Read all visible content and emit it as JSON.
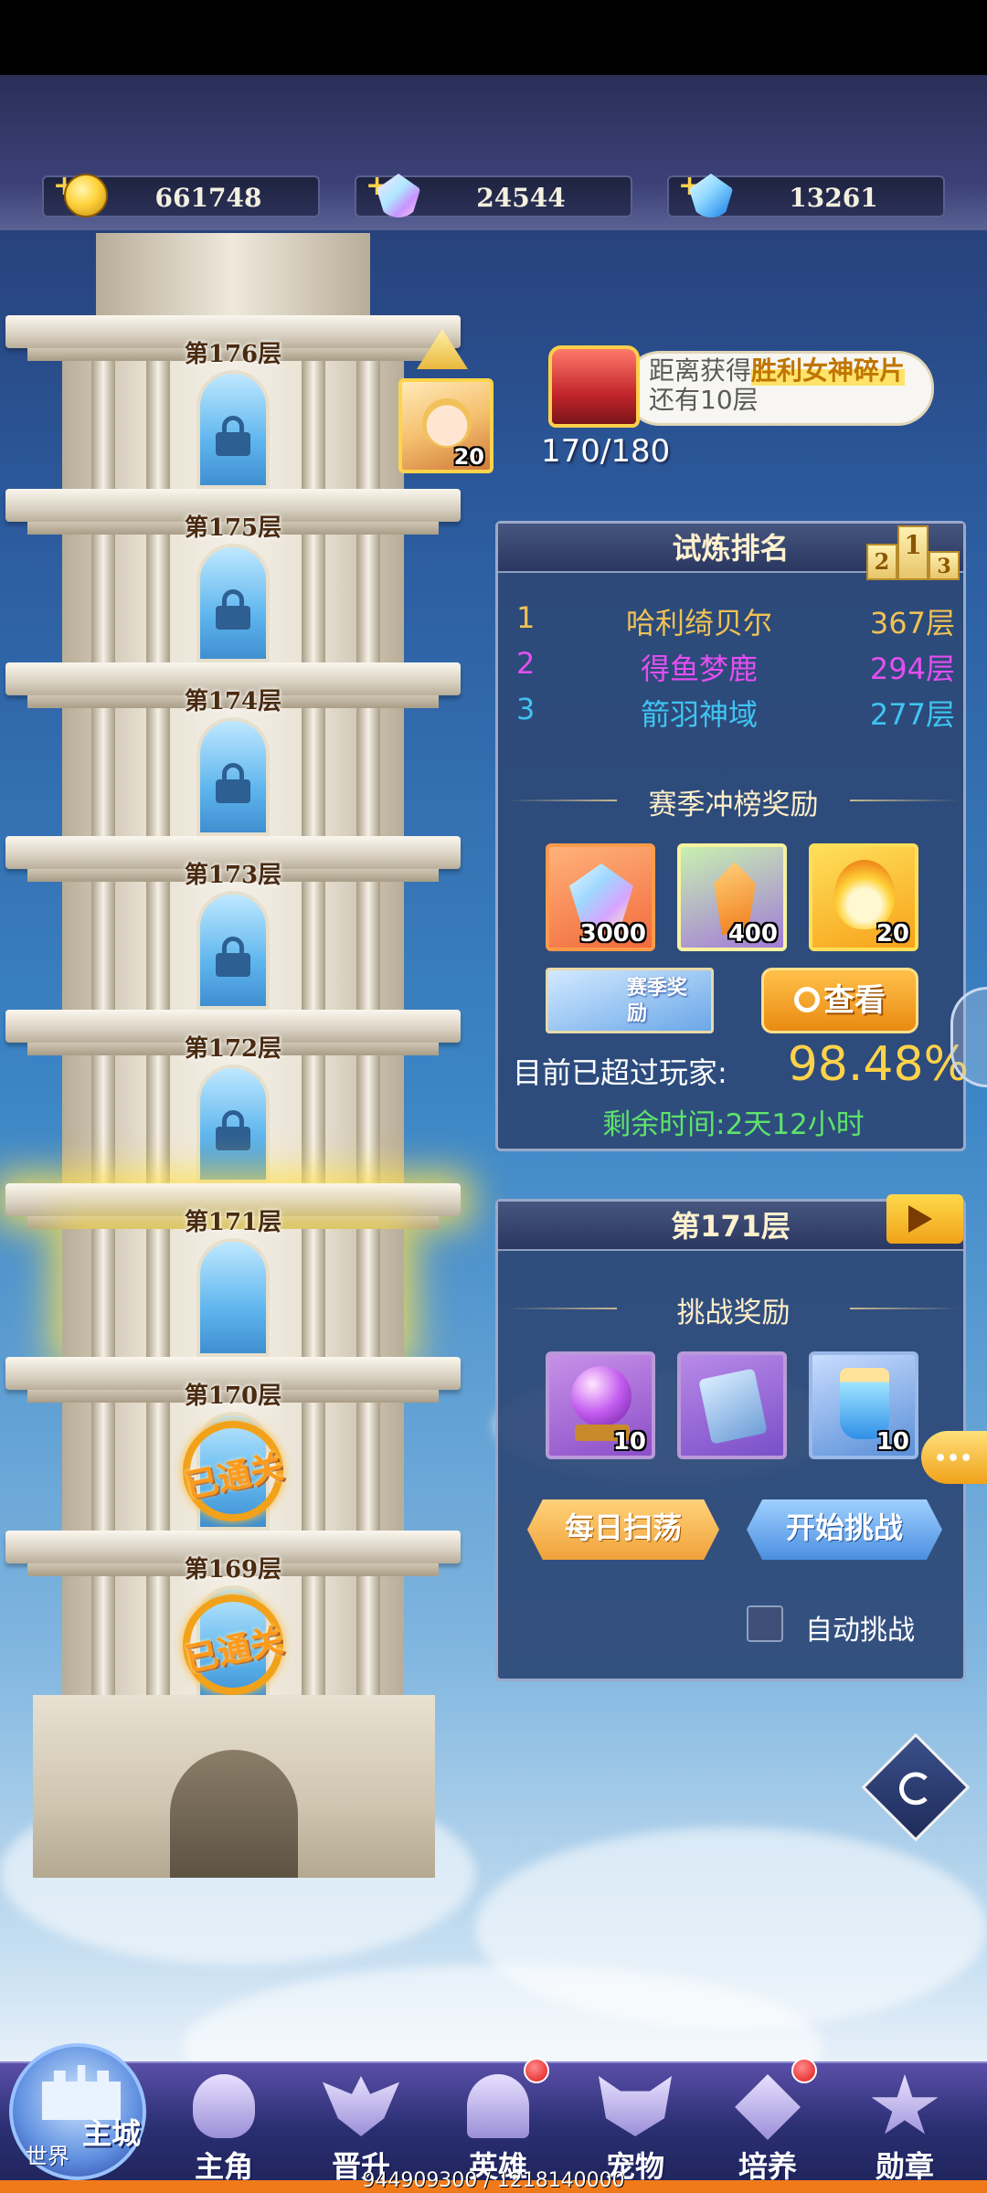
{
  "currencies": [
    {
      "icon": "gold-coin-icon",
      "value": "661748"
    },
    {
      "icon": "rainbow-gem-icon",
      "value": "24544"
    },
    {
      "icon": "blue-diamond-icon",
      "value": "13261"
    }
  ],
  "tower": {
    "floors": [
      {
        "label": "第176层",
        "state": "locked"
      },
      {
        "label": "第175层",
        "state": "locked"
      },
      {
        "label": "第174层",
        "state": "locked"
      },
      {
        "label": "第173层",
        "state": "locked"
      },
      {
        "label": "第172层",
        "state": "locked"
      },
      {
        "label": "第171层",
        "state": "current"
      },
      {
        "label": "第170层",
        "state": "cleared"
      },
      {
        "label": "第169层",
        "state": "cleared"
      }
    ],
    "cleared_text": "已通关",
    "hero_avatar_level": "20"
  },
  "chest": {
    "text_before": "距离获得",
    "highlight": "胜利女神碎片",
    "text_after": "还有10层",
    "progress": "170/180"
  },
  "ranking": {
    "title": "试炼排名",
    "podium": [
      "1",
      "2",
      "3"
    ],
    "rows": [
      {
        "rank": "1",
        "name": "哈利绮贝尔",
        "floor": "367层",
        "color": "#f0c254"
      },
      {
        "rank": "2",
        "name": "得鱼梦鹿",
        "floor": "294层",
        "color": "#e34ff0"
      },
      {
        "rank": "3",
        "name": "箭羽神域",
        "floor": "277层",
        "color": "#3fc4f0"
      }
    ],
    "season_reward_title": "赛季冲榜奖励",
    "rewards": [
      {
        "icon": "crystal-icon",
        "qty": "3000"
      },
      {
        "icon": "orange-shard-icon",
        "qty": "400"
      },
      {
        "icon": "flame-essence-icon",
        "qty": "20"
      }
    ],
    "season_badge": "赛季奖励",
    "view_button": "查看",
    "surpass_label": "目前已超过玩家:",
    "surpass_value": "98.48%",
    "remaining": "剩余时间:2天12小时"
  },
  "floor_panel": {
    "title": "第171层",
    "challenge_reward_title": "挑战奖励",
    "rewards": [
      {
        "icon": "purple-orb-icon",
        "qty": "10"
      },
      {
        "icon": "blue-card-icon",
        "qty": ""
      },
      {
        "icon": "potion-icon",
        "qty": "10"
      }
    ],
    "daily_sweep": "每日扫荡",
    "start_challenge": "开始挑战",
    "auto_challenge": "自动挑战"
  },
  "nav": {
    "world_label": "世界",
    "main_city": "主城",
    "items": [
      {
        "label": "主角",
        "icon": "hero-head-icon",
        "badge": false
      },
      {
        "label": "晋升",
        "icon": "wings-icon",
        "badge": false
      },
      {
        "label": "英雄",
        "icon": "helmet-icon",
        "badge": true
      },
      {
        "label": "宠物",
        "icon": "beast-icon",
        "badge": false
      },
      {
        "label": "培养",
        "icon": "compass-icon",
        "badge": true
      },
      {
        "label": "勋章",
        "icon": "medal-icon",
        "badge": false
      }
    ],
    "exp_text": "944909300 / 1218140000"
  }
}
